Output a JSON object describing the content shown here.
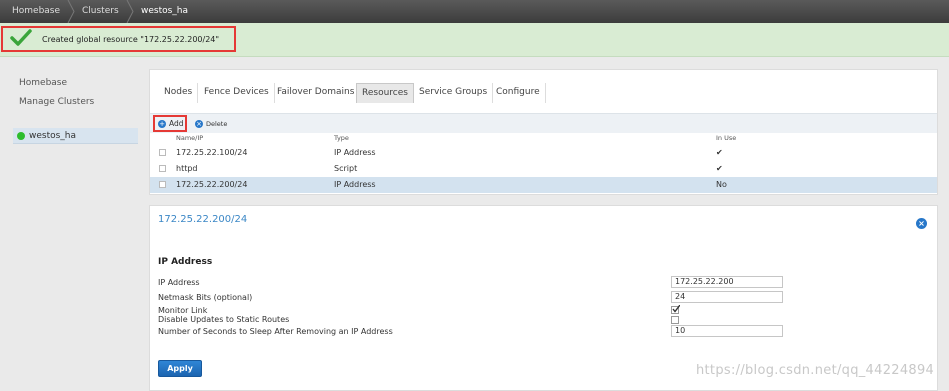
{
  "breadcrumb": [
    "Homebase",
    "Clusters",
    "westos_ha"
  ],
  "notice": {
    "message": "Created global resource \"172.25.22.200/24\""
  },
  "leftnav": {
    "links": [
      "Homebase",
      "Manage Clusters"
    ],
    "cluster": "westos_ha"
  },
  "tabs": [
    {
      "label": "Nodes",
      "active": false
    },
    {
      "label": "Fence Devices",
      "active": false
    },
    {
      "label": "Failover Domains",
      "active": false
    },
    {
      "label": "Resources",
      "active": true
    },
    {
      "label": "Service Groups",
      "active": false
    },
    {
      "label": "Configure",
      "active": false
    }
  ],
  "toolbar": {
    "add_label": "Add",
    "delete_label": "Delete"
  },
  "table": {
    "columns": [
      "Name/IP",
      "Type",
      "In Use"
    ],
    "rows": [
      {
        "name": "172.25.22.100/24",
        "type": "IP Address",
        "in_use": "✔",
        "selected": false
      },
      {
        "name": "httpd",
        "type": "Script",
        "in_use": "✔",
        "selected": false
      },
      {
        "name": "172.25.22.200/24",
        "type": "IP Address",
        "in_use": "No",
        "selected": true
      }
    ]
  },
  "detail": {
    "title": "172.25.22.200/24",
    "section": "IP Address",
    "fields": {
      "ip_label": "IP Address",
      "ip_value": "172.25.22.200",
      "netmask_label": "Netmask Bits (optional)",
      "netmask_value": "24",
      "monitor_label": "Monitor Link",
      "monitor_checked": true,
      "disable_label": "Disable Updates to Static Routes",
      "disable_checked": false,
      "sleep_label": "Number of Seconds to Sleep After Removing an IP Address",
      "sleep_value": "10"
    },
    "apply_label": "Apply"
  },
  "watermark": "https://blog.csdn.net/qq_44224894",
  "colors": {
    "accent": "#2777c9",
    "success_bg": "#d9ecd3",
    "highlight": "#e53935",
    "selected_row": "#d3e2ef"
  }
}
